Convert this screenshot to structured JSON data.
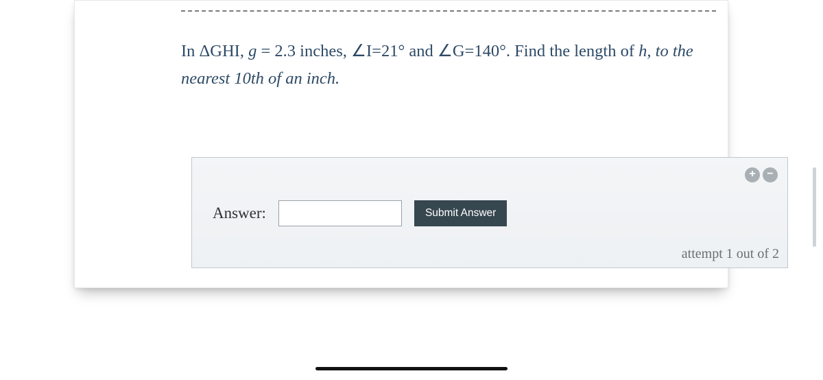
{
  "question": {
    "prefix": "In ΔGHI, ",
    "var_g": "g",
    "mid1": " = 2.3 inches, ∠I=21° and ∠G=140°. Find the length of ",
    "var_h": "h,",
    "tail_italic": " to the nearest 10th of an inch."
  },
  "answer_box": {
    "label": "Answer:",
    "input_value": "",
    "submit_label": "Submit Answer",
    "attempt_text": "attempt 1 out of 2",
    "zoom_in_glyph": "+",
    "zoom_out_glyph": "−"
  }
}
